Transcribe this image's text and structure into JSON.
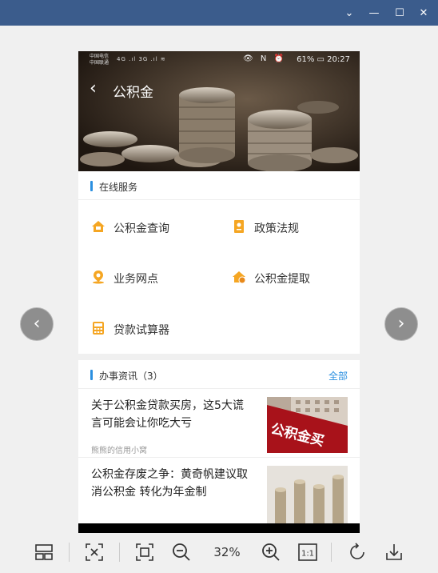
{
  "window": {
    "controls": {
      "chevron": "⌄",
      "minimize": "—",
      "maximize": "☐",
      "close": "✕"
    }
  },
  "viewer": {
    "prev_arrow": "‹",
    "next_arrow": "›",
    "zoom": "32%"
  },
  "phone": {
    "status": {
      "carrier1": "中国电信",
      "carrier2": "中国联通",
      "signal": "4G .ıl 3G .ıl ≋",
      "icons": "👁 N ⏰",
      "battery_time": "61%  ▭ 20:27"
    },
    "header": {
      "back": "‹",
      "title": "公积金"
    },
    "online": {
      "title": "在线服务",
      "items": [
        {
          "label": "公积金查询",
          "icon": "house-icon"
        },
        {
          "label": "政策法规",
          "icon": "document-icon"
        },
        {
          "label": "业务网点",
          "icon": "location-icon"
        },
        {
          "label": "公积金提取",
          "icon": "house-withdraw-icon"
        },
        {
          "label": "贷款试算器",
          "icon": "calculator-icon"
        }
      ]
    },
    "news": {
      "title": "办事资讯（3）",
      "more": "全部",
      "items": [
        {
          "title": "关于公积金贷款买房，这5大谎言可能会让你吃大亏",
          "source": "熊熊的信用小窝",
          "thumb_text": "公积金买"
        },
        {
          "title": "公积金存废之争：黄奇帆建议取消公积金 转化为年金制",
          "source": ""
        }
      ]
    },
    "navbar": {
      "down": "⌄",
      "back": "◁",
      "home": "○",
      "recent": "□"
    }
  },
  "colors": {
    "accent": "#2a8fe0",
    "icon_orange": "#f5a623",
    "titlebar": "#3b5c8c"
  }
}
